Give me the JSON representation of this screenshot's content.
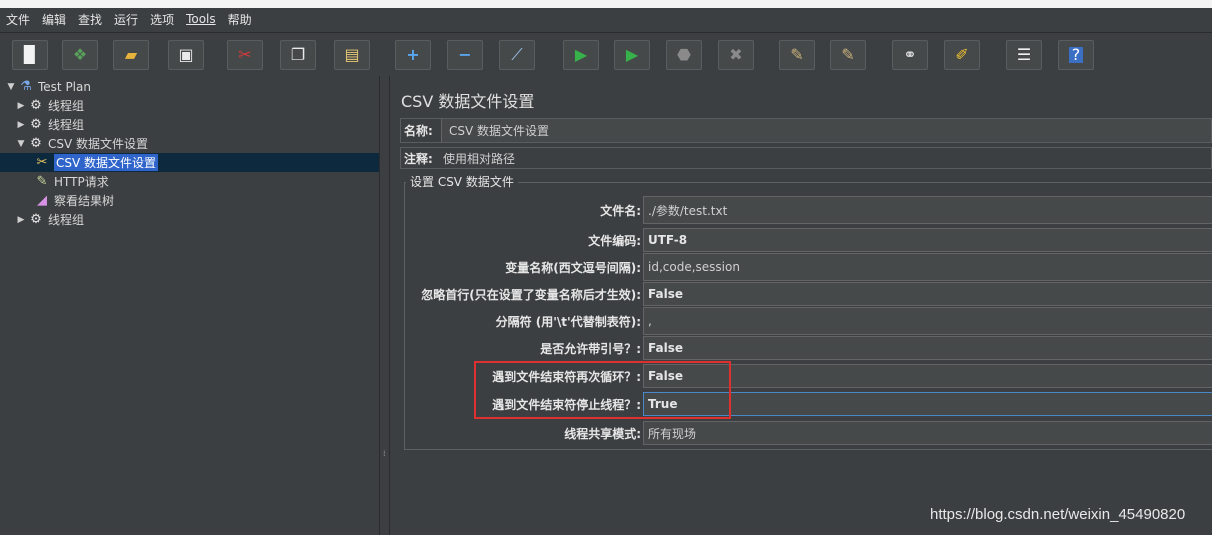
{
  "menu": [
    "文件",
    "编辑",
    "查找",
    "运行",
    "选项",
    "Tools",
    "帮助"
  ],
  "toolbar_icons": [
    "new-icon",
    "templates-icon",
    "open-icon",
    "save-icon",
    "cut-icon",
    "copy-icon",
    "paste-icon",
    "expand-icon",
    "collapse-icon",
    "toggle-icon",
    "start-icon",
    "start-no-pauses-icon",
    "stop-icon",
    "shutdown-icon",
    "clear-icon",
    "clear-all-icon",
    "search-icon",
    "reset-search-icon",
    "function-helper-icon",
    "help-icon"
  ],
  "tree": {
    "test_plan": "Test Plan",
    "thread_group_1": "线程组",
    "thread_group_2": "线程组",
    "thread_group_3": "CSV 数据文件设置",
    "csv_config": "CSV 数据文件设置",
    "http_request": "HTTP请求",
    "result_tree": "察看结果树",
    "thread_group_4": "线程组"
  },
  "panel": {
    "title": "CSV 数据文件设置",
    "name_label": "名称:",
    "name_value": "CSV 数据文件设置",
    "comment_label": "注释:",
    "comment_value": "使用相对路径",
    "group_title": "设置 CSV 数据文件"
  },
  "fields": [
    {
      "label": "文件名:",
      "value": "./参数/test.txt"
    },
    {
      "label": "文件编码:",
      "value": "UTF-8"
    },
    {
      "label": "变量名称(西文逗号间隔):",
      "value": "id,code,session"
    },
    {
      "label": "忽略首行(只在设置了变量名称后才生效):",
      "value": "False"
    },
    {
      "label": "分隔符 (用'\\t'代替制表符):",
      "value": ","
    },
    {
      "label": "是否允许带引号？:",
      "value": "False"
    },
    {
      "label": "遇到文件结束符再次循环？:",
      "value": "False"
    },
    {
      "label": "遇到文件结束符停止线程？:",
      "value": "True"
    },
    {
      "label": "线程共享模式:",
      "value": "所有现场"
    }
  ],
  "watermark": "https://blog.csdn.net/weixin_45490820",
  "colors": {
    "background": "#3c3f41",
    "selection": "#2f65ca",
    "highlight_box": "#e02f2f"
  }
}
